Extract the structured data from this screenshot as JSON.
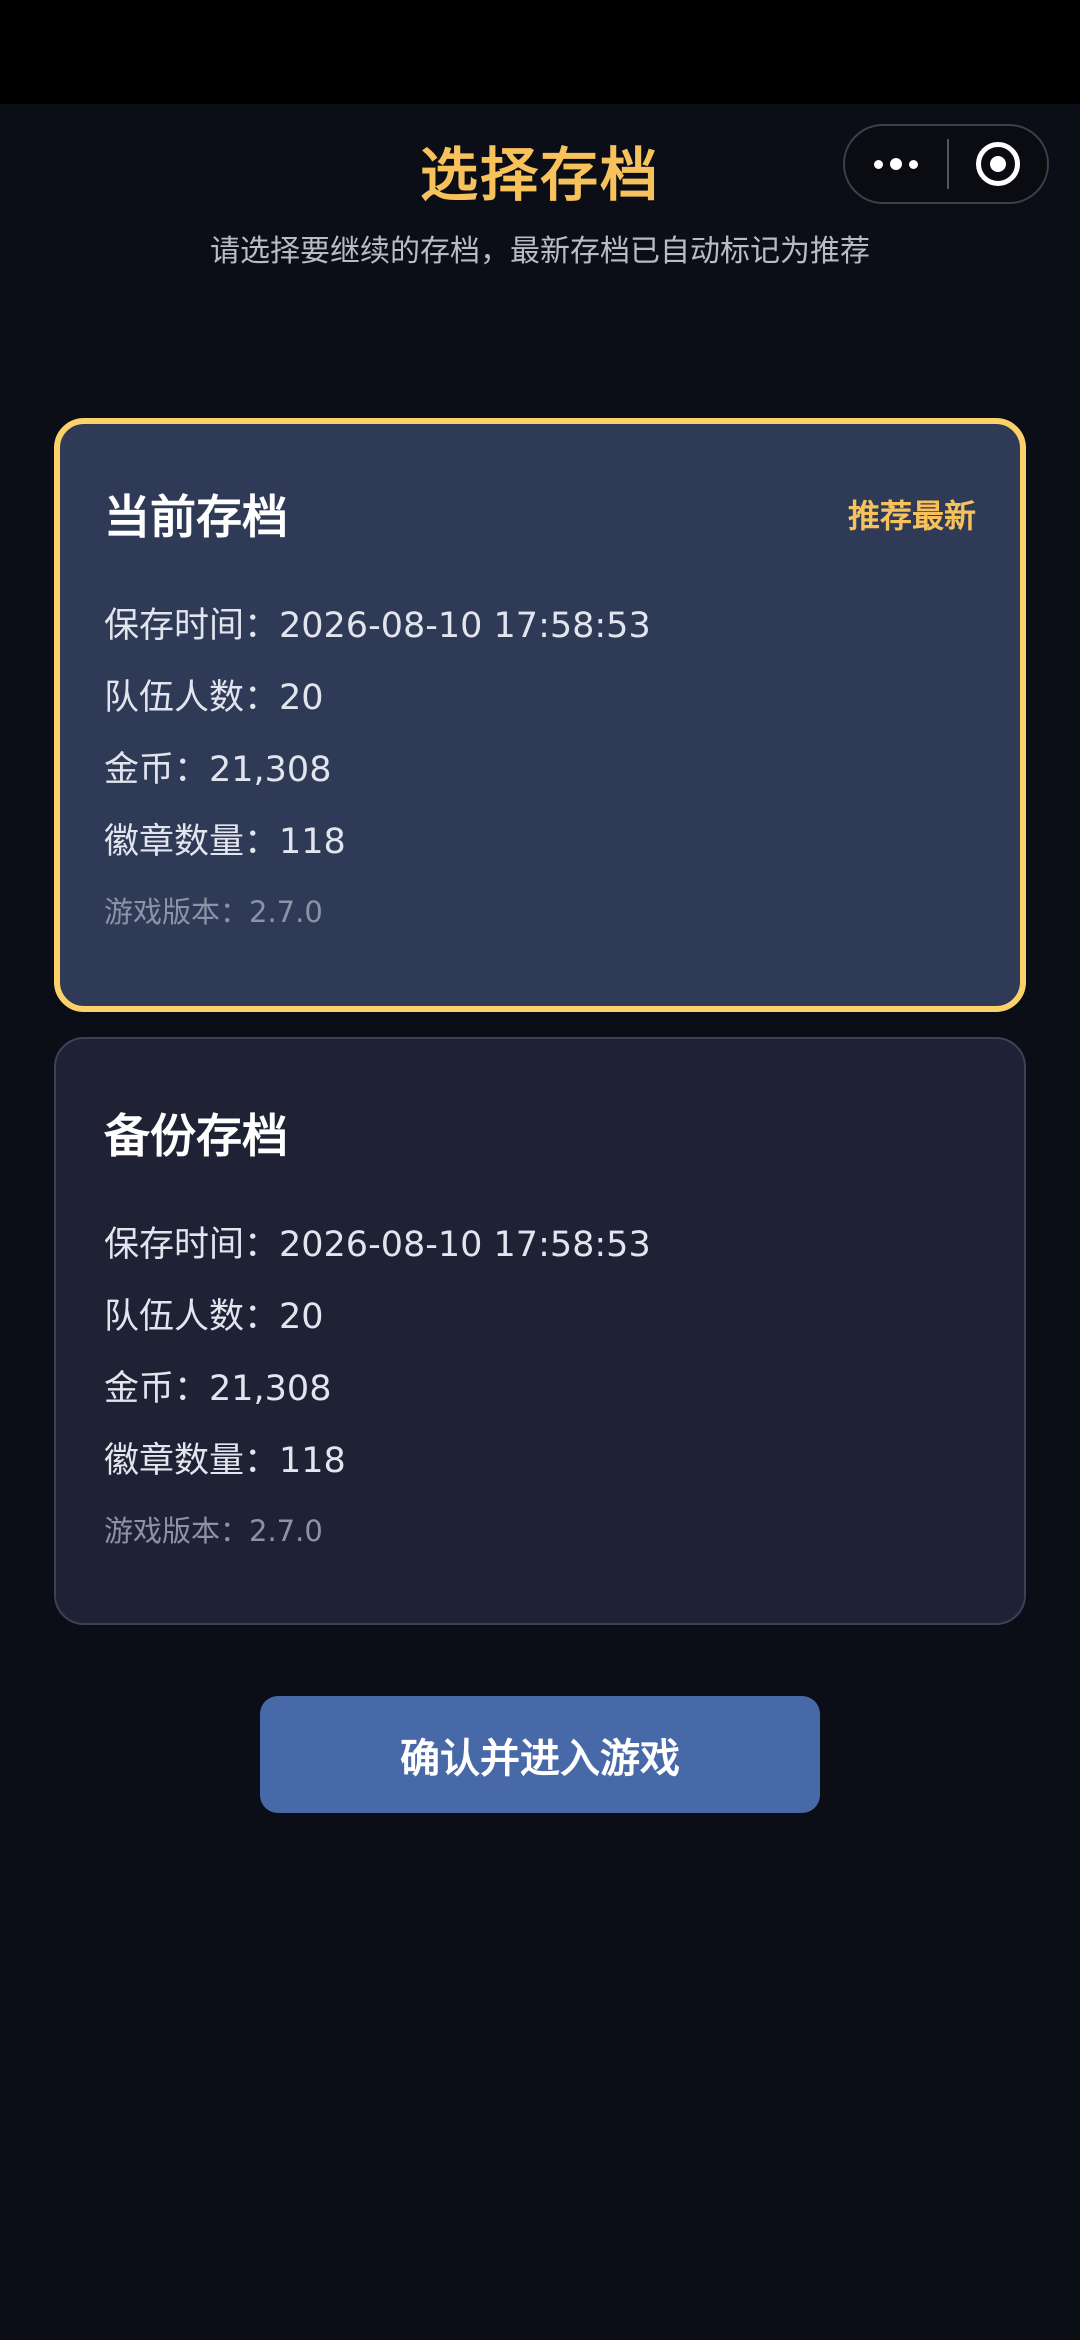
{
  "header": {
    "title": "选择存档",
    "subtitle": "请选择要继续的存档，最新存档已自动标记为推荐"
  },
  "capsule": {
    "more_icon": "more-dots-icon",
    "close_icon": "target-icon"
  },
  "accent_color": "#f7c15c",
  "saves": [
    {
      "title": "当前存档",
      "badge": "推荐最新",
      "save_time": "保存时间：2026-08-10 17:58:53",
      "team_size": "队伍人数：20",
      "gold": "金币：21,308",
      "badges": "徽章数量：118",
      "version": "游戏版本：2.7.0",
      "selected": true
    },
    {
      "title": "备份存档",
      "save_time": "保存时间：2026-08-10 17:58:53",
      "team_size": "队伍人数：20",
      "gold": "金币：21,308",
      "badges": "徽章数量：118",
      "version": "游戏版本：2.7.0",
      "selected": false
    }
  ],
  "confirm_button": "确认并进入游戏"
}
